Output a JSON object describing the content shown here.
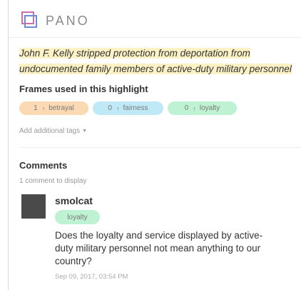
{
  "app": {
    "brand": "PANO",
    "icon": "pano-logo-icon"
  },
  "highlight": {
    "text": "John F. Kelly stripped protection from deportation from undocumented family members of active-duty military personnel"
  },
  "frames": {
    "title": "Frames used in this highlight",
    "tags": [
      {
        "count": "1",
        "arrow": "↑",
        "label": "betrayal",
        "color": "#fbd9b3"
      },
      {
        "count": "0",
        "arrow": "↑",
        "label": "fairness",
        "color": "#bfe9f6"
      },
      {
        "count": "0",
        "arrow": "↑",
        "label": "loyalty",
        "color": "#bff2d2"
      }
    ],
    "add_tags": "Add additional tags",
    "add_tags_icon": "caret-down-icon"
  },
  "comments": {
    "title": "Comments",
    "count_text": "1 comment to display",
    "items": [
      {
        "username": "smolcat",
        "tag": "loyalty",
        "text": "Does the loyalty and service displayed by active-duty military personnel not mean anything to our country?",
        "date": "Sep 09, 2017, 03:54 PM"
      }
    ]
  }
}
